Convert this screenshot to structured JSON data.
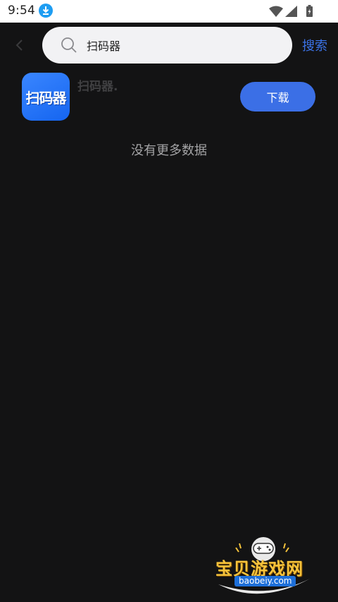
{
  "status_bar": {
    "time": "9:54"
  },
  "header": {
    "search_value": "扫码器",
    "search_placeholder": "",
    "search_button_label": "搜索"
  },
  "results": [
    {
      "icon_text": "扫码器",
      "name": "扫码器.",
      "action_label": "下载"
    }
  ],
  "footer_message": "没有更多数据",
  "watermark": {
    "title": "宝贝游戏网",
    "url": "baobeiy.com"
  },
  "colors": {
    "background": "#131314",
    "accent": "#3b6fe6",
    "link": "#3b73e8"
  }
}
